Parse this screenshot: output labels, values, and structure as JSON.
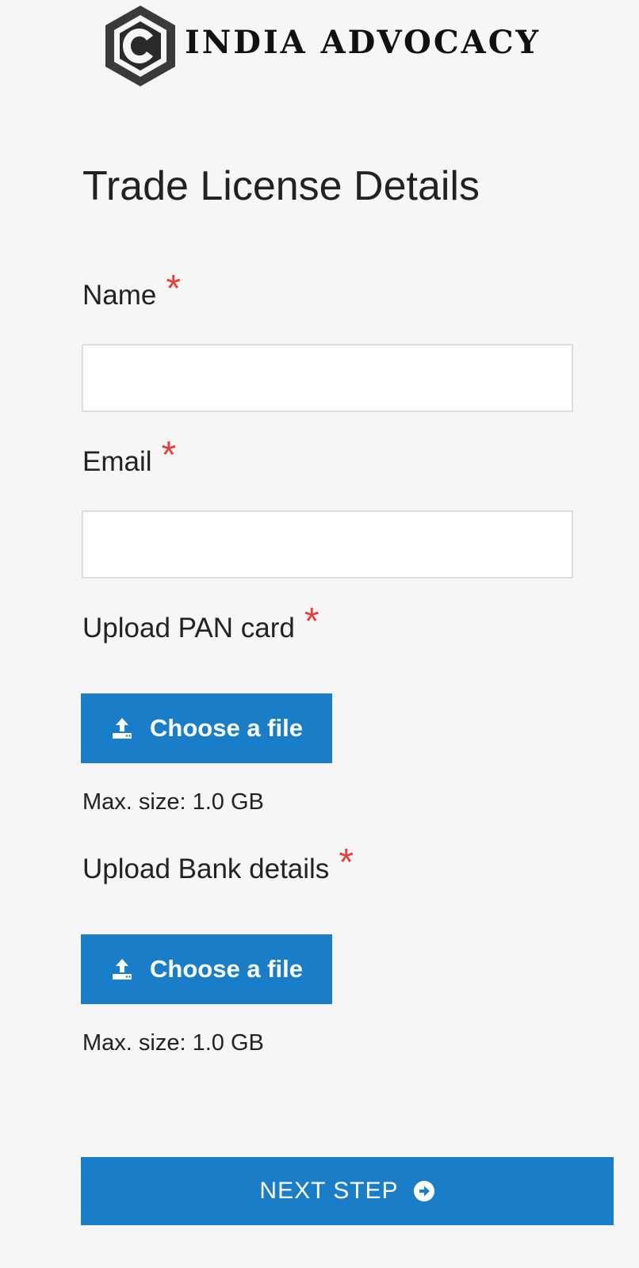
{
  "brand": {
    "name": "INDIA ADVOCACY"
  },
  "form": {
    "title": "Trade License Details",
    "fields": {
      "name": {
        "label": "Name",
        "required_mark": "*",
        "value": "",
        "placeholder": ""
      },
      "email": {
        "label": "Email",
        "required_mark": "*",
        "value": "",
        "placeholder": ""
      },
      "pan_card": {
        "label": "Upload PAN card",
        "required_mark": "*",
        "button_label": "Choose a file",
        "button_icon": "upload-icon",
        "size_note": "Max. size: 1.0 GB"
      },
      "bank_details": {
        "label": "Upload Bank details",
        "required_mark": "*",
        "button_label": "Choose a file",
        "button_icon": "upload-icon",
        "size_note": "Max. size: 1.0 GB"
      }
    },
    "next_button": {
      "label": "NEXT STEP",
      "icon": "arrow-circle-right-icon"
    }
  },
  "colors": {
    "background": "#f6f6f6",
    "primary_button": "#1a7dc8",
    "required_star": "#e4403b",
    "input_border": "#dddddd",
    "text": "#222222"
  }
}
